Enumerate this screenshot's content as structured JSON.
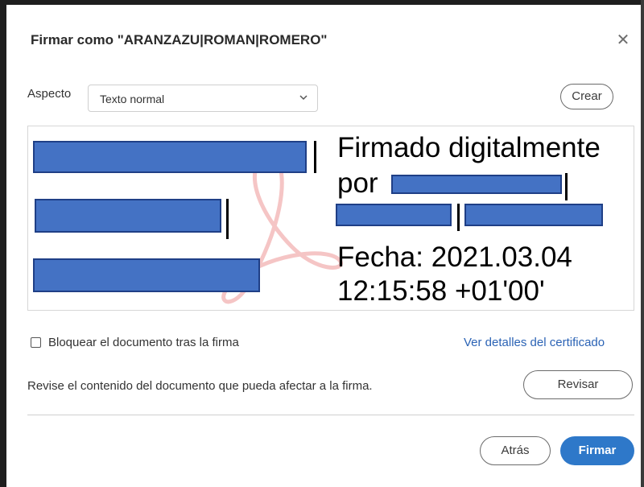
{
  "dialog": {
    "title": "Firmar como \"ARANZAZU|ROMAN|ROMERO\"",
    "close_icon": "close-icon"
  },
  "aspect": {
    "label": "Aspecto",
    "selected": "Texto normal",
    "create_label": "Crear"
  },
  "signature_preview": {
    "line1": "Firmado digitalmente",
    "line2": "por",
    "line4": "Fecha: 2021.03.04",
    "line5": "12:15:58 +01'00'",
    "redaction_color": "#4472c4"
  },
  "options": {
    "lock_label": "Bloquear el documento tras la firma",
    "lock_checked": false,
    "certificate_link": "Ver detalles del certificado"
  },
  "review": {
    "note": "Revise el contenido del documento que pueda afectar a la firma.",
    "button_label": "Revisar"
  },
  "footer": {
    "back_label": "Atrás",
    "sign_label": "Firmar",
    "accent": "#2e78c9"
  }
}
